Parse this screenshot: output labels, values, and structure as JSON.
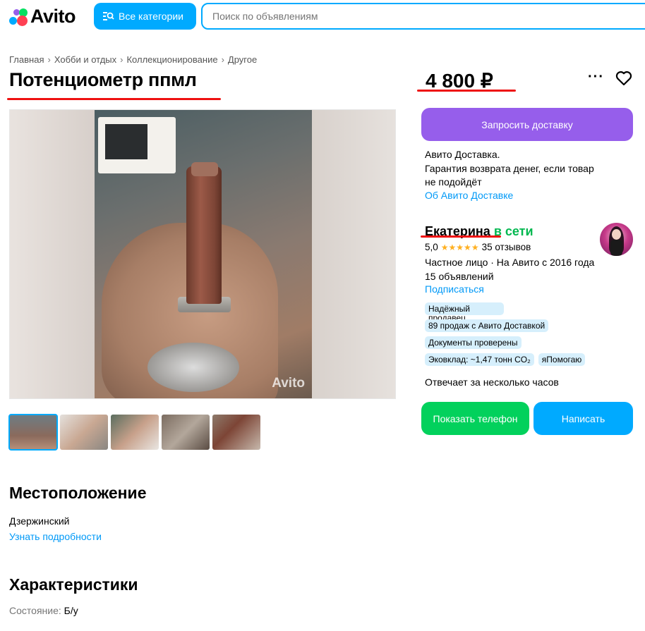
{
  "header": {
    "logo_text": "Avito",
    "categories_button": "Все категории",
    "search_placeholder": "Поиск по объявлениям"
  },
  "breadcrumb": [
    "Главная",
    "Хобби и отдых",
    "Коллекционирование",
    "Другое"
  ],
  "listing": {
    "title": "Потенциометр ппмл",
    "price": "4 800 ₽",
    "more_glyph": "···",
    "photo_watermark": "Avito"
  },
  "delivery": {
    "button": "Запросить доставку",
    "line1": "Авито Доставка.",
    "line2": "Гарантия возврата денег, если товар",
    "line3": "не подойдёт",
    "link": "Об Авито Доставке"
  },
  "seller": {
    "name": "Екатерина",
    "status": "в сети",
    "rating": "5,0",
    "stars": "★★★★★",
    "reviews": "35 отзывов",
    "type_since": "Частное лицо · На Авито с 2016 года",
    "ads_count": "15 объявлений",
    "subscribe": "Подписаться",
    "badges": [
      "Надёжный продавец",
      "89 продаж с Авито Доставкой",
      "Документы проверены",
      "Эковклад: ~1,47 тонн CO₂",
      "яПомогаю"
    ],
    "response_time": "Отвечает за несколько часов",
    "phone_button": "Показать телефон",
    "write_button": "Написать"
  },
  "location": {
    "heading": "Местоположение",
    "place": "Дзержинский",
    "link": "Узнать подробности"
  },
  "characteristics": {
    "heading": "Характеристики",
    "condition_label": "Состояние:",
    "condition_value": "Б/у"
  },
  "colors": {
    "brand_blue": "#00aaff",
    "purple": "#965eeb",
    "green": "#02d15c",
    "annotation_red": "#e11"
  }
}
